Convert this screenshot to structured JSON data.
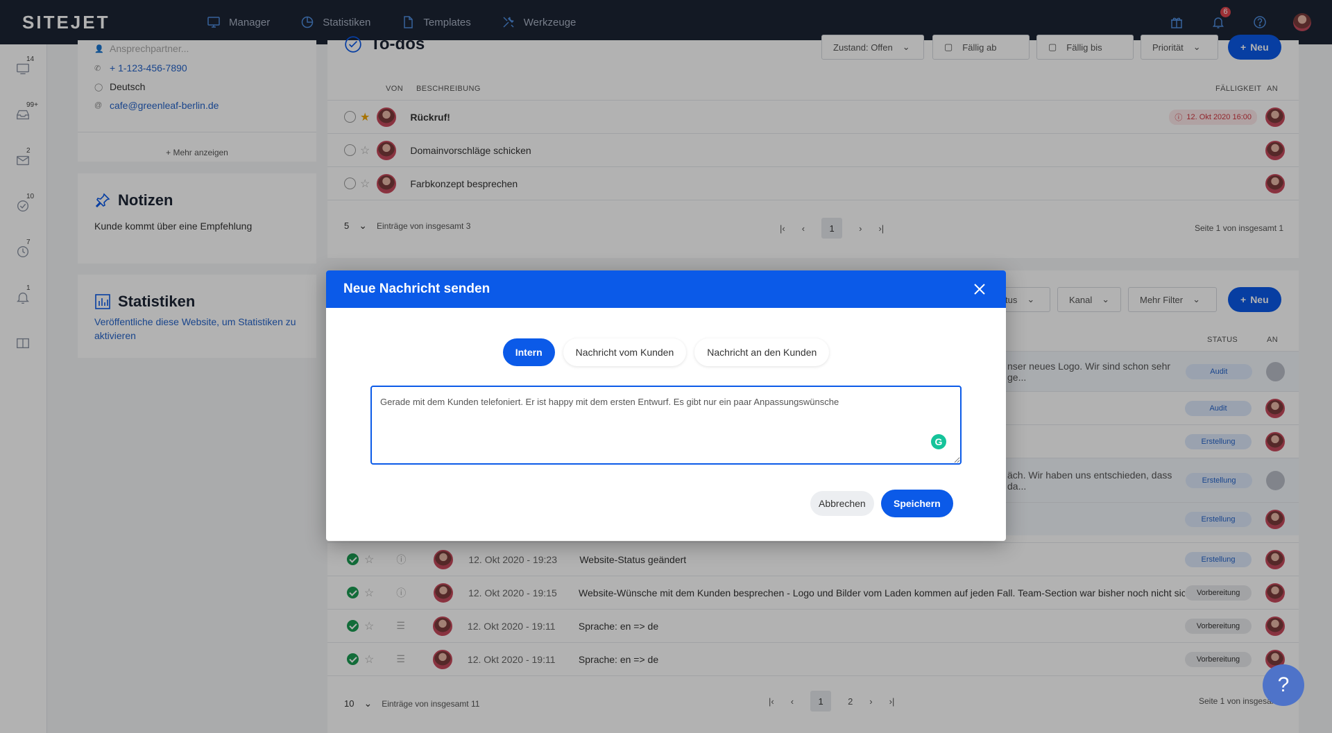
{
  "app": {
    "logo": "SITEJET"
  },
  "nav": [
    {
      "label": "Manager",
      "icon": "monitor-icon"
    },
    {
      "label": "Statistiken",
      "icon": "pie-chart-icon"
    },
    {
      "label": "Templates",
      "icon": "file-icon"
    },
    {
      "label": "Werkzeuge",
      "icon": "tools-icon"
    }
  ],
  "topright": {
    "notifications_count": "6"
  },
  "sidebar": {
    "items": [
      {
        "icon": "monitor-icon",
        "badge": "14"
      },
      {
        "icon": "inbox-icon",
        "badge": "99+"
      },
      {
        "icon": "mail-icon",
        "badge": "2"
      },
      {
        "icon": "task-check-icon",
        "badge": "10"
      },
      {
        "icon": "clock-icon",
        "badge": "7"
      },
      {
        "icon": "bell-icon",
        "badge": "1"
      },
      {
        "icon": "book-icon",
        "badge": ""
      }
    ]
  },
  "contact": {
    "contact_person_placeholder": "Ansprechpartner...",
    "phone": "+ 1-123-456-7890",
    "language": "Deutsch",
    "email": "cafe@greenleaf-berlin.de",
    "more": "+ Mehr anzeigen"
  },
  "notes": {
    "title": "Notizen",
    "text": "Kunde kommt über eine Empfehlung"
  },
  "stats": {
    "title": "Statistiken",
    "text": "Veröffentliche diese Website, um Statistiken zu aktivieren"
  },
  "todos": {
    "title": "To-dos",
    "filters": {
      "state": "Zustand: Offen",
      "due_from": "Fällig ab",
      "due_to": "Fällig bis",
      "priority": "Priorität"
    },
    "new_label": "Neu",
    "columns": {
      "from": "VON",
      "description": "BESCHREIBUNG",
      "due": "FÄLLIGKEIT",
      "to": "AN"
    },
    "rows": [
      {
        "title": "Rückruf!",
        "starred": true,
        "due": "12. Okt 2020 16:00"
      },
      {
        "title": "Domainvorschläge schicken",
        "starred": false,
        "due": ""
      },
      {
        "title": "Farbkonzept besprechen",
        "starred": false,
        "due": ""
      }
    ],
    "page_size": "5",
    "entries_text": "Einträge von insgesamt 3",
    "current_page": "1",
    "page_info": "Seite 1 von insgesamt 1"
  },
  "messages": {
    "filters": {
      "status": "tus",
      "channel": "Kanal",
      "more": "Mehr Filter"
    },
    "new_label": "Neu",
    "columns": {
      "status": "STATUS",
      "to": "AN"
    },
    "hidden_rows": [
      {
        "snippet": "nser neues Logo.  Wir sind schon sehr ge...",
        "status": "Audit",
        "avatar": "gray"
      },
      {
        "snippet": "",
        "status": "Audit",
        "avatar": "user"
      },
      {
        "snippet": "",
        "status": "Erstellung",
        "avatar": "user"
      },
      {
        "snippet": "äch. Wir haben uns entschieden, dass da...",
        "status": "Erstellung",
        "avatar": "gray"
      },
      {
        "snippet": "",
        "status": "Erstellung",
        "avatar": "user"
      }
    ],
    "rows": [
      {
        "date": "12. Okt 2020 - 19:23",
        "text": "Website-Status geändert",
        "status": "Erstellung",
        "type_icon": "info-icon"
      },
      {
        "date": "12. Okt 2020 - 19:15",
        "text": "Website-Wünsche mit dem Kunden besprechen - Logo und Bilder vom Laden kommen auf jeden Fall. Team-Section war bisher noch nicht sicher....",
        "status": "Vorbereitung",
        "type_icon": "info-icon"
      },
      {
        "date": "12. Okt 2020 - 19:11",
        "text": "Sprache: en => de",
        "status": "Vorbereitung",
        "type_icon": "database-icon"
      },
      {
        "date": "12. Okt 2020 - 19:11",
        "text": "Sprache: en => de",
        "status": "Vorbereitung",
        "type_icon": "database-icon"
      }
    ],
    "page_size": "10",
    "entries_text": "Einträge von insgesamt 11",
    "pages": [
      "1",
      "2"
    ],
    "page_info": "Seite 1 von insgesamt"
  },
  "modal": {
    "title": "Neue Nachricht senden",
    "tabs": [
      "Intern",
      "Nachricht vom Kunden",
      "Nachricht an den Kunden"
    ],
    "active_tab": "Intern",
    "message": "Gerade mit dem Kunden telefoniert. Er ist happy mit dem ersten Entwurf. Es gibt nur ein paar Anpassungswünsche",
    "cancel": "Abbrechen",
    "save": "Speichern"
  },
  "help": {
    "label": "?"
  },
  "colors": {
    "primary": "#0b5ae8",
    "topbar": "#1c2434",
    "danger": "#d0353f",
    "success": "#1b9b52"
  }
}
